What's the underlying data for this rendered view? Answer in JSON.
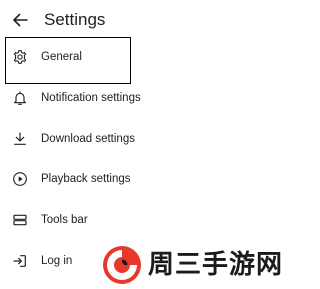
{
  "header": {
    "back_icon": "arrow-left-icon",
    "title": "Settings"
  },
  "menu": {
    "items": [
      {
        "label": "General",
        "icon": "gear-icon",
        "selected": true
      },
      {
        "label": "Notification settings",
        "icon": "bell-icon"
      },
      {
        "label": "Download settings",
        "icon": "download-icon"
      },
      {
        "label": "Playback settings",
        "icon": "play-circle-icon"
      },
      {
        "label": "Tools bar",
        "icon": "toolbar-icon"
      },
      {
        "label": "Log in",
        "icon": "login-icon"
      }
    ]
  },
  "watermark": {
    "text": "周三手游网",
    "logo_colors": [
      "#e8372b",
      "#1b1b1b"
    ]
  }
}
